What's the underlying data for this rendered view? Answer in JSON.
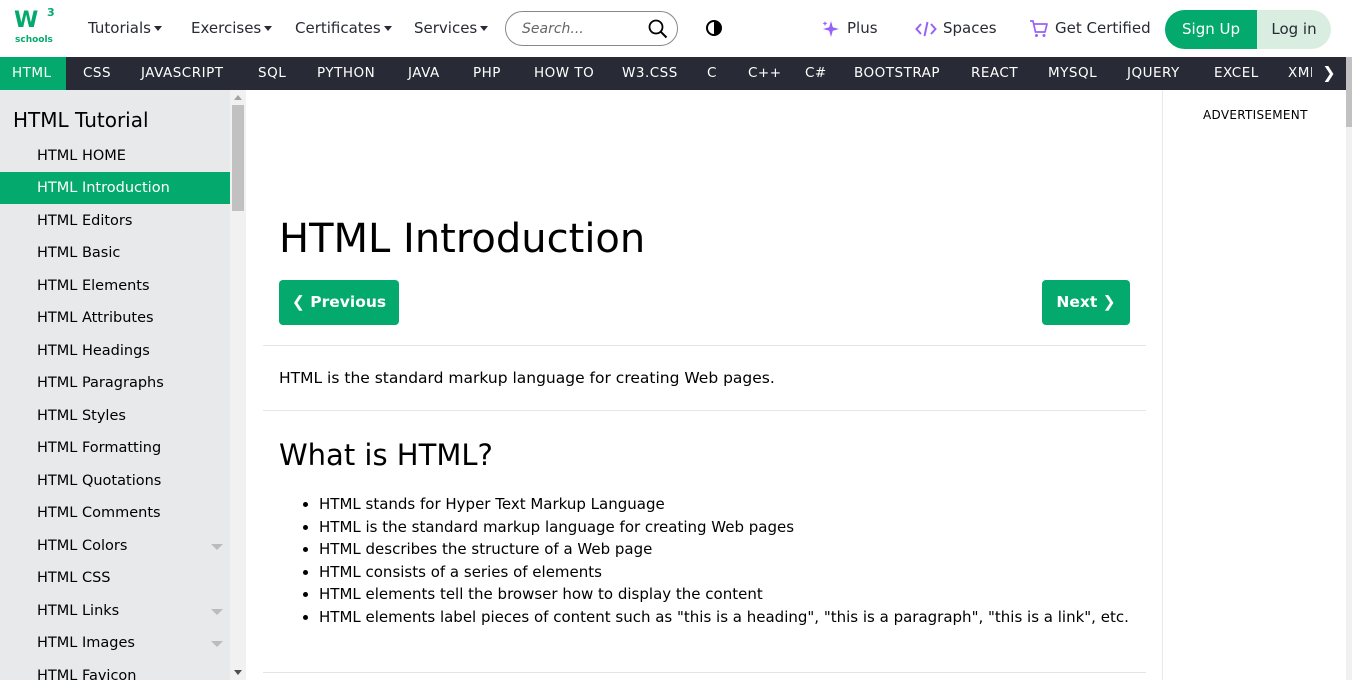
{
  "logo": {
    "main": "W",
    "sup": "3",
    "sub": "schools"
  },
  "topnav": {
    "menus": [
      {
        "label": "Tutorials"
      },
      {
        "label": "Exercises"
      },
      {
        "label": "Certificates"
      },
      {
        "label": "Services"
      }
    ],
    "search_placeholder": "Search...",
    "links": {
      "plus": "Plus",
      "spaces": "Spaces",
      "get_certified": "Get Certified"
    },
    "signup": "Sign Up",
    "login": "Log in"
  },
  "langnav": {
    "items": [
      "HTML",
      "CSS",
      "JAVASCRIPT",
      "SQL",
      "PYTHON",
      "JAVA",
      "PHP",
      "HOW TO",
      "W3.CSS",
      "C",
      "C++",
      "C#",
      "BOOTSTRAP",
      "REACT",
      "MYSQL",
      "JQUERY",
      "EXCEL",
      "XML"
    ],
    "active": "HTML"
  },
  "sidebar": {
    "title": "HTML Tutorial",
    "items": [
      {
        "label": "HTML HOME"
      },
      {
        "label": "HTML Introduction",
        "active": true
      },
      {
        "label": "HTML Editors"
      },
      {
        "label": "HTML Basic"
      },
      {
        "label": "HTML Elements"
      },
      {
        "label": "HTML Attributes"
      },
      {
        "label": "HTML Headings"
      },
      {
        "label": "HTML Paragraphs"
      },
      {
        "label": "HTML Styles"
      },
      {
        "label": "HTML Formatting"
      },
      {
        "label": "HTML Quotations"
      },
      {
        "label": "HTML Comments"
      },
      {
        "label": "HTML Colors",
        "expandable": true
      },
      {
        "label": "HTML CSS"
      },
      {
        "label": "HTML Links",
        "expandable": true
      },
      {
        "label": "HTML Images",
        "expandable": true
      },
      {
        "label": "HTML Favicon"
      }
    ]
  },
  "main": {
    "title": "HTML Introduction",
    "prev_label": "Previous",
    "next_label": "Next",
    "intro": "HTML is the standard markup language for creating Web pages.",
    "section_title": "What is HTML?",
    "bullets": [
      "HTML stands for Hyper Text Markup Language",
      "HTML is the standard markup language for creating Web pages",
      "HTML describes the structure of a Web page",
      "HTML consists of a series of elements",
      "HTML elements tell the browser how to display the content",
      "HTML elements label pieces of content such as \"this is a heading\", \"this is a paragraph\", \"this is a link\", etc."
    ]
  },
  "right": {
    "ad_label": "ADVERTISEMENT"
  },
  "colors": {
    "accent": "#04AA6D",
    "dark_nav": "#282A35",
    "sidebar_bg": "#E7E9EB",
    "login_bg": "#D9EEE1",
    "plus_purple": "#9763F6"
  }
}
